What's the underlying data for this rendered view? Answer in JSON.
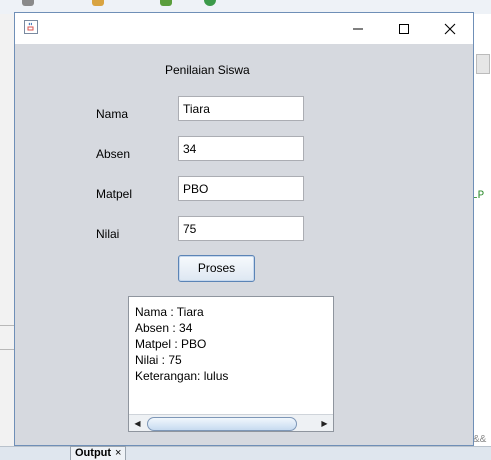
{
  "background": {
    "right_code_snippet": "LP",
    "right_partial_text": "&&",
    "output_tab_label": "Output",
    "output_tab_close": "×"
  },
  "window": {
    "app_icon": "java-cup-icon",
    "controls": {
      "minimize": "minimize-icon",
      "maximize": "maximize-icon",
      "close": "close-icon"
    }
  },
  "form": {
    "heading": "Penilaian Siswa",
    "fields": [
      {
        "label": "Nama",
        "value": "Tiara"
      },
      {
        "label": "Absen",
        "value": "34"
      },
      {
        "label": "Matpel",
        "value": "PBO"
      },
      {
        "label": "Nilai",
        "value": "75"
      }
    ],
    "button_label": "Proses"
  },
  "output": {
    "lines": [
      "Nama : Tiara",
      "Absen : 34",
      "Matpel : PBO",
      "Nilai : 75",
      "Keterangan: lulus"
    ],
    "scroll_left_icon": "arrow-left-icon",
    "scroll_right_icon": "arrow-right-icon"
  },
  "colors": {
    "frame_bg": "#d6d9df",
    "frame_border": "#6f8fb7",
    "button_border": "#5b84b6"
  }
}
